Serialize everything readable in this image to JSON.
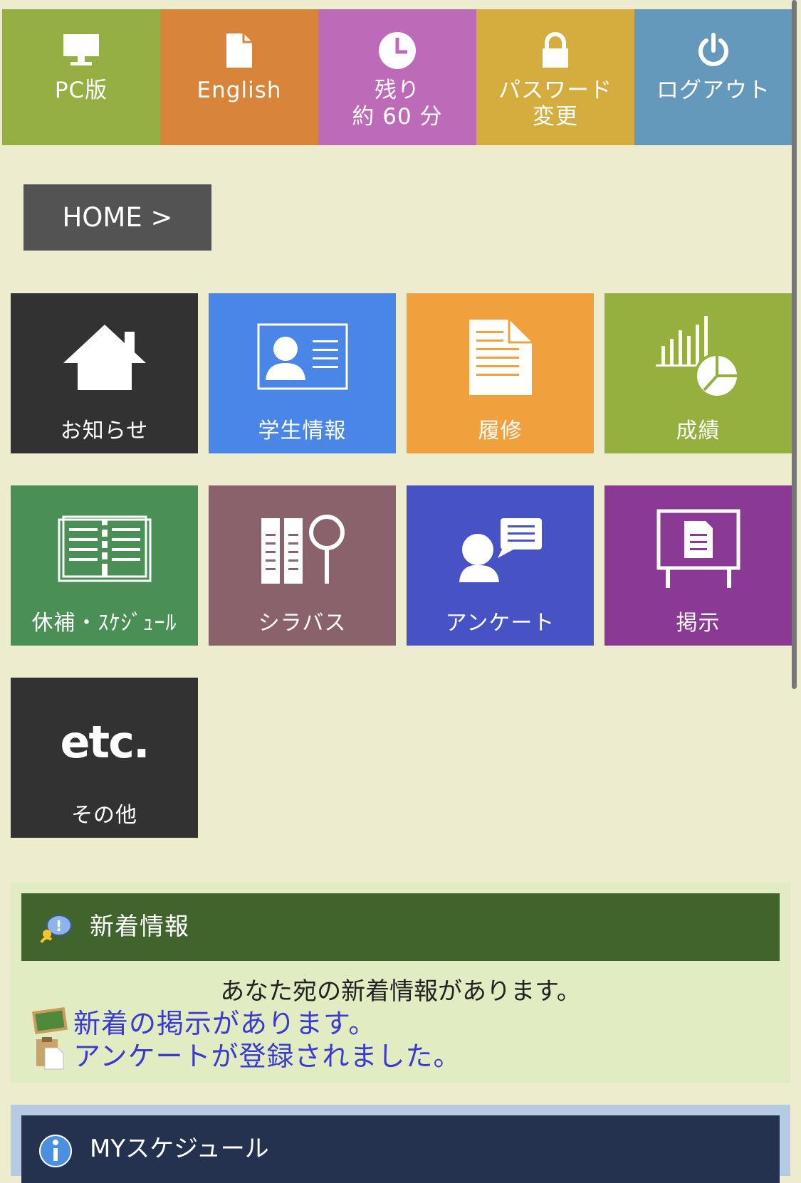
{
  "topbar": [
    {
      "label": "PC版",
      "color": "#94b043",
      "icon": "monitor-icon"
    },
    {
      "label": "English",
      "color": "#d8843b",
      "icon": "document-icon"
    },
    {
      "label": "残り\n約 60 分",
      "color": "#bd6bb8",
      "icon": "clock-icon"
    },
    {
      "label": "パスワード\n変更",
      "color": "#d4ad3e",
      "icon": "lock-icon"
    },
    {
      "label": "ログアウト",
      "color": "#6499bc",
      "icon": "power-icon"
    }
  ],
  "breadcrumb": {
    "label": "HOME >"
  },
  "tiles": [
    {
      "label": "お知らせ",
      "color": "#323232",
      "icon": "house-icon"
    },
    {
      "label": "学生情報",
      "color": "#4a86e8",
      "icon": "id-card-icon"
    },
    {
      "label": "履修",
      "color": "#f0a03c",
      "icon": "document-icon"
    },
    {
      "label": "成績",
      "color": "#95b03f",
      "icon": "chart-icon"
    },
    {
      "label": "休補・ｽｹｼﾞｭｰﾙ",
      "color": "#4a8f55",
      "icon": "notebook-icon"
    },
    {
      "label": "シラバス",
      "color": "#8a626c",
      "icon": "books-search-icon"
    },
    {
      "label": "アンケート",
      "color": "#4753c4",
      "icon": "person-speech-icon"
    },
    {
      "label": "掲示",
      "color": "#8a3a95",
      "icon": "notice-board-icon"
    },
    {
      "label": "その他",
      "color": "#323232",
      "icon": "etc-icon",
      "icon_text": "etc."
    }
  ],
  "news": {
    "title": "新着情報",
    "summary": "あなた宛の新着情報があります。",
    "items": [
      {
        "label": "新着の掲示があります。",
        "icon": "blackboard-icon"
      },
      {
        "label": "アンケートが登録されました。",
        "icon": "clipboard-icon"
      }
    ]
  },
  "schedule": {
    "title": "MYスケジュール",
    "icon": "info-icon"
  }
}
